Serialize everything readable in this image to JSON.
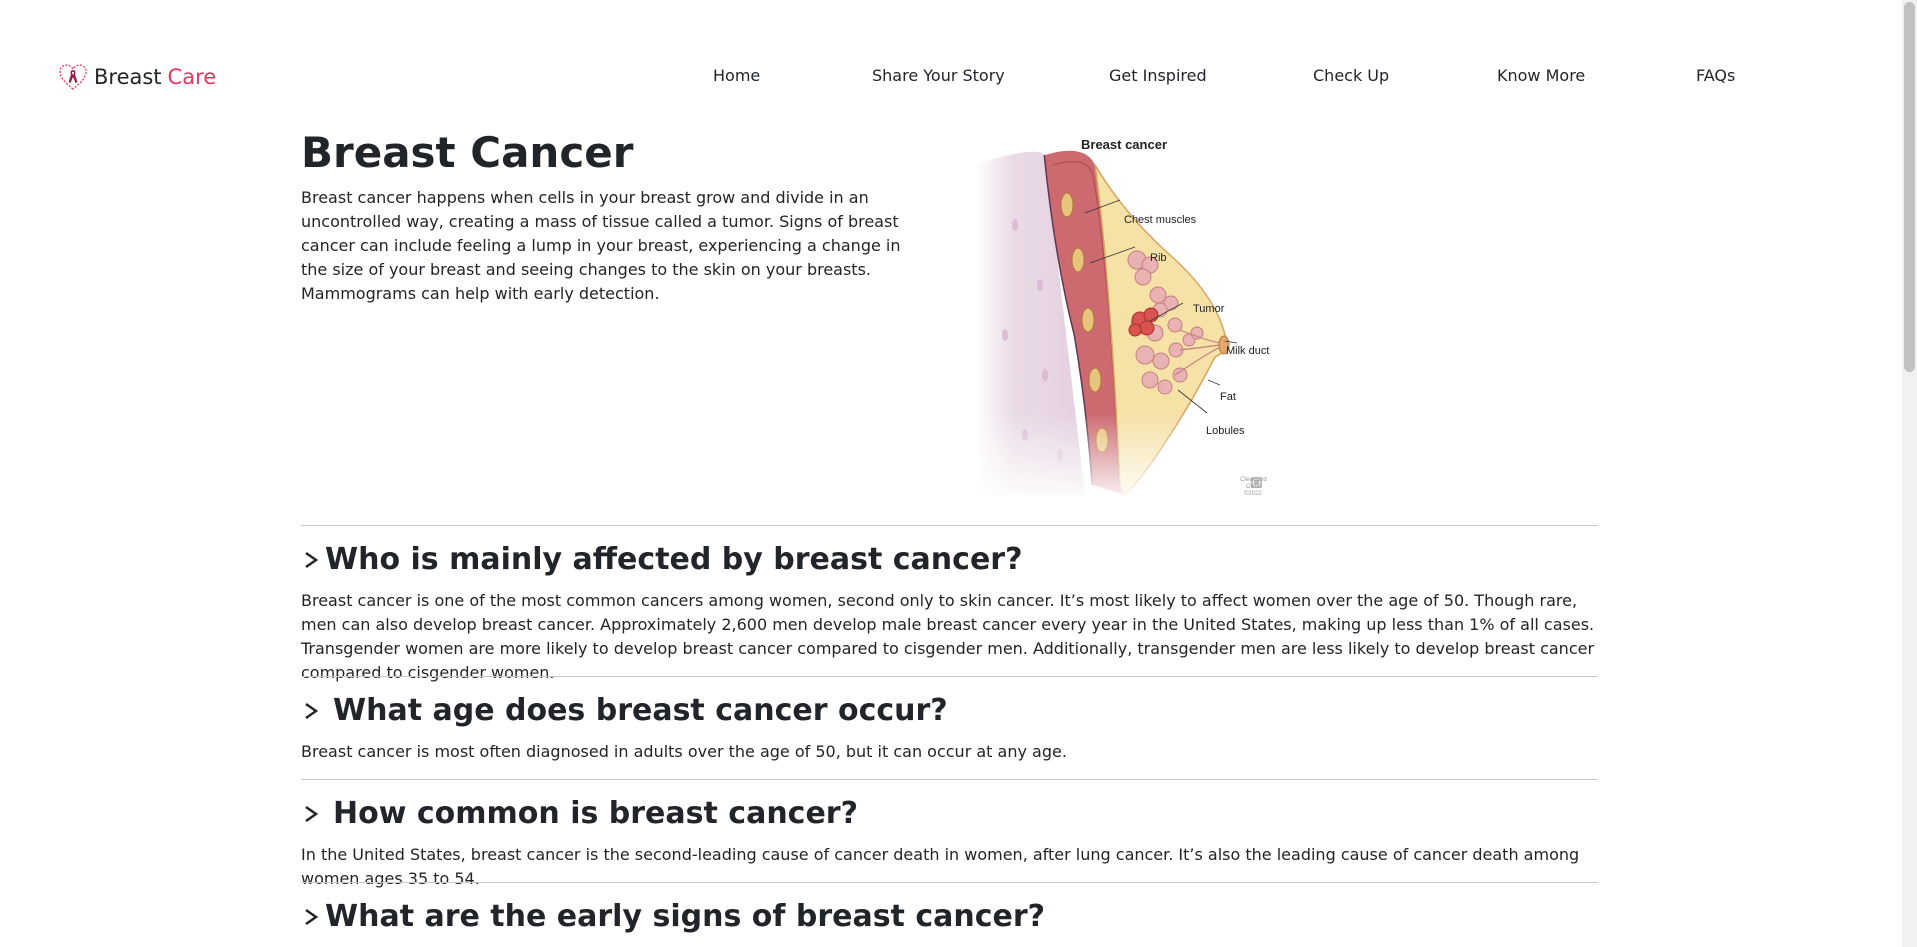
{
  "brand": {
    "name_part1": "Breast",
    "name_part2": "Care",
    "logo_icon": "ribbon-heart-icon"
  },
  "nav": {
    "links": [
      "Home",
      "Share Your Story",
      "Get Inspired",
      "Check Up",
      "Know More",
      "FAQs"
    ]
  },
  "hero": {
    "title": "Breast Cancer",
    "text": "Breast cancer happens when cells in your breast grow and divide in an uncontrolled way, creating a mass of tissue called a tumor. Signs of breast cancer can include feeling a lump in your breast, experiencing a change in the size of your breast and seeing changes to the skin on your breasts. Mammograms can help with early detection."
  },
  "illustration": {
    "title": "Breast cancer",
    "labels": [
      "Chest muscles",
      "Rib",
      "Tumor",
      "Milk duct",
      "Fat",
      "Lobules"
    ],
    "credit": [
      "Cleveland",
      "Clinic",
      "©2022"
    ]
  },
  "faq": [
    {
      "question": "Who is mainly affected by breast cancer?",
      "answer": "Breast cancer is one of the most common cancers among women, second only to skin cancer. It’s most likely to affect women over the age of 50. Though rare, men can also develop breast cancer. Approximately 2,600 men develop male breast cancer every year in the United States, making up less than 1% of all cases. Transgender women are more likely to develop breast cancer compared to cisgender men. Additionally, transgender men are less likely to develop breast cancer compared to cisgender women."
    },
    {
      "question": "What age does breast cancer occur?",
      "answer": "Breast cancer is most often diagnosed in adults over the age of 50, but it can occur at any age."
    },
    {
      "question": "How common is breast cancer?",
      "answer": "In the United States, breast cancer is the second-leading cause of cancer death in women, after lung cancer. It’s also the leading cause of cancer death among women ages 35 to 54."
    },
    {
      "question": "What are the early signs of breast cancer?",
      "answer": ""
    }
  ],
  "colors": {
    "accent": "#e8365f",
    "text": "#212529",
    "divider": "#c8c8c8"
  }
}
